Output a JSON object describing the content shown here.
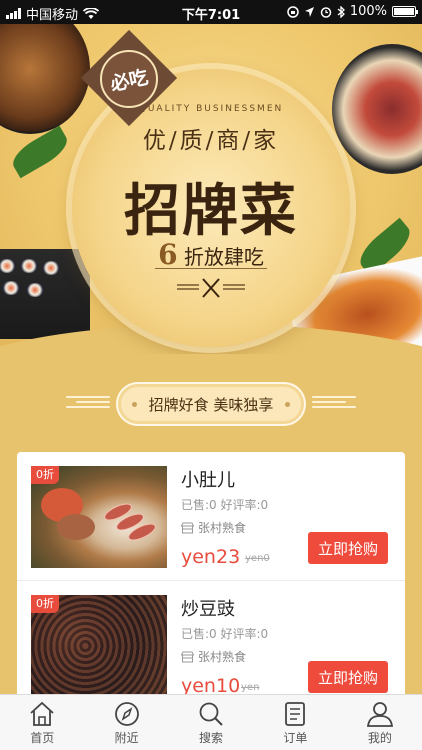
{
  "status_bar": {
    "carrier": "中国移动",
    "time": "下午7:01",
    "battery": "100%"
  },
  "banner": {
    "badge": "必吃",
    "subtitle": "QUALITY BUSINESSMEN",
    "line1": "优/质/商/家",
    "title": "招牌菜",
    "discount_number": "6",
    "discount_text": "折放肆吃"
  },
  "slogan": "招牌好食 美味独享",
  "products": [
    {
      "discount_tag": "0折",
      "name": "小肚儿",
      "stats": "已售:0 好评率:0",
      "shop": "张村熟食",
      "price": "yen23",
      "original_price": "yen0",
      "buy_label": "立即抢购"
    },
    {
      "discount_tag": "0折",
      "name": "炒豆豉",
      "stats": "已售:0 好评率:0",
      "shop": "张村熟食",
      "price": "yen10",
      "original_price": "yen",
      "buy_label": "立即抢购"
    }
  ],
  "tabbar": [
    {
      "label": "首页",
      "icon": "home-icon"
    },
    {
      "label": "附近",
      "icon": "compass-icon"
    },
    {
      "label": "搜索",
      "icon": "search-icon"
    },
    {
      "label": "订单",
      "icon": "order-list-icon"
    },
    {
      "label": "我的",
      "icon": "user-icon"
    }
  ],
  "colors": {
    "background": "#e8c36d",
    "accent": "#ee4b3d",
    "title_brown": "#3a2410"
  }
}
